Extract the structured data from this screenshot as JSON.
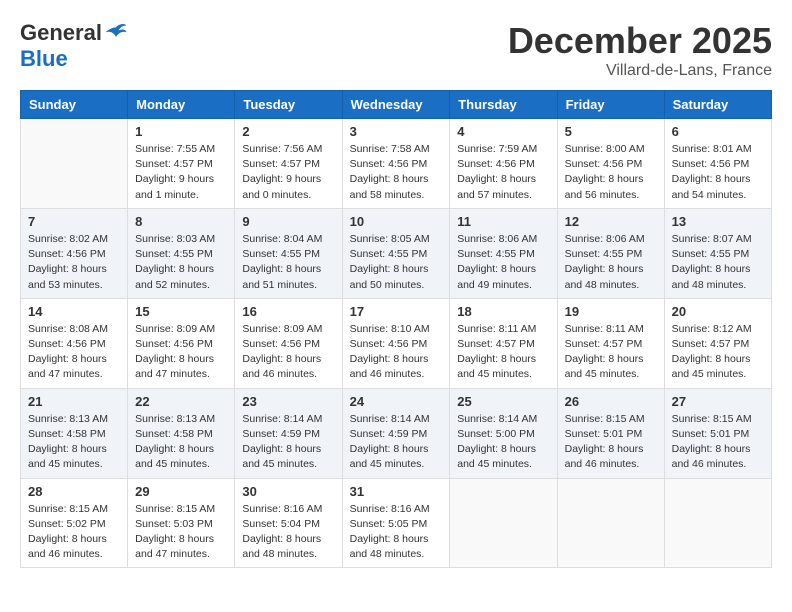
{
  "header": {
    "logo_general": "General",
    "logo_blue": "Blue",
    "title": "December 2025",
    "subtitle": "Villard-de-Lans, France"
  },
  "days_of_week": [
    "Sunday",
    "Monday",
    "Tuesday",
    "Wednesday",
    "Thursday",
    "Friday",
    "Saturday"
  ],
  "weeks": [
    [
      {
        "day": "",
        "info": ""
      },
      {
        "day": "1",
        "info": "Sunrise: 7:55 AM\nSunset: 4:57 PM\nDaylight: 9 hours\nand 1 minute."
      },
      {
        "day": "2",
        "info": "Sunrise: 7:56 AM\nSunset: 4:57 PM\nDaylight: 9 hours\nand 0 minutes."
      },
      {
        "day": "3",
        "info": "Sunrise: 7:58 AM\nSunset: 4:56 PM\nDaylight: 8 hours\nand 58 minutes."
      },
      {
        "day": "4",
        "info": "Sunrise: 7:59 AM\nSunset: 4:56 PM\nDaylight: 8 hours\nand 57 minutes."
      },
      {
        "day": "5",
        "info": "Sunrise: 8:00 AM\nSunset: 4:56 PM\nDaylight: 8 hours\nand 56 minutes."
      },
      {
        "day": "6",
        "info": "Sunrise: 8:01 AM\nSunset: 4:56 PM\nDaylight: 8 hours\nand 54 minutes."
      }
    ],
    [
      {
        "day": "7",
        "info": "Sunrise: 8:02 AM\nSunset: 4:56 PM\nDaylight: 8 hours\nand 53 minutes."
      },
      {
        "day": "8",
        "info": "Sunrise: 8:03 AM\nSunset: 4:55 PM\nDaylight: 8 hours\nand 52 minutes."
      },
      {
        "day": "9",
        "info": "Sunrise: 8:04 AM\nSunset: 4:55 PM\nDaylight: 8 hours\nand 51 minutes."
      },
      {
        "day": "10",
        "info": "Sunrise: 8:05 AM\nSunset: 4:55 PM\nDaylight: 8 hours\nand 50 minutes."
      },
      {
        "day": "11",
        "info": "Sunrise: 8:06 AM\nSunset: 4:55 PM\nDaylight: 8 hours\nand 49 minutes."
      },
      {
        "day": "12",
        "info": "Sunrise: 8:06 AM\nSunset: 4:55 PM\nDaylight: 8 hours\nand 48 minutes."
      },
      {
        "day": "13",
        "info": "Sunrise: 8:07 AM\nSunset: 4:55 PM\nDaylight: 8 hours\nand 48 minutes."
      }
    ],
    [
      {
        "day": "14",
        "info": "Sunrise: 8:08 AM\nSunset: 4:56 PM\nDaylight: 8 hours\nand 47 minutes."
      },
      {
        "day": "15",
        "info": "Sunrise: 8:09 AM\nSunset: 4:56 PM\nDaylight: 8 hours\nand 47 minutes."
      },
      {
        "day": "16",
        "info": "Sunrise: 8:09 AM\nSunset: 4:56 PM\nDaylight: 8 hours\nand 46 minutes."
      },
      {
        "day": "17",
        "info": "Sunrise: 8:10 AM\nSunset: 4:56 PM\nDaylight: 8 hours\nand 46 minutes."
      },
      {
        "day": "18",
        "info": "Sunrise: 8:11 AM\nSunset: 4:57 PM\nDaylight: 8 hours\nand 45 minutes."
      },
      {
        "day": "19",
        "info": "Sunrise: 8:11 AM\nSunset: 4:57 PM\nDaylight: 8 hours\nand 45 minutes."
      },
      {
        "day": "20",
        "info": "Sunrise: 8:12 AM\nSunset: 4:57 PM\nDaylight: 8 hours\nand 45 minutes."
      }
    ],
    [
      {
        "day": "21",
        "info": "Sunrise: 8:13 AM\nSunset: 4:58 PM\nDaylight: 8 hours\nand 45 minutes."
      },
      {
        "day": "22",
        "info": "Sunrise: 8:13 AM\nSunset: 4:58 PM\nDaylight: 8 hours\nand 45 minutes."
      },
      {
        "day": "23",
        "info": "Sunrise: 8:14 AM\nSunset: 4:59 PM\nDaylight: 8 hours\nand 45 minutes."
      },
      {
        "day": "24",
        "info": "Sunrise: 8:14 AM\nSunset: 4:59 PM\nDaylight: 8 hours\nand 45 minutes."
      },
      {
        "day": "25",
        "info": "Sunrise: 8:14 AM\nSunset: 5:00 PM\nDaylight: 8 hours\nand 45 minutes."
      },
      {
        "day": "26",
        "info": "Sunrise: 8:15 AM\nSunset: 5:01 PM\nDaylight: 8 hours\nand 46 minutes."
      },
      {
        "day": "27",
        "info": "Sunrise: 8:15 AM\nSunset: 5:01 PM\nDaylight: 8 hours\nand 46 minutes."
      }
    ],
    [
      {
        "day": "28",
        "info": "Sunrise: 8:15 AM\nSunset: 5:02 PM\nDaylight: 8 hours\nand 46 minutes."
      },
      {
        "day": "29",
        "info": "Sunrise: 8:15 AM\nSunset: 5:03 PM\nDaylight: 8 hours\nand 47 minutes."
      },
      {
        "day": "30",
        "info": "Sunrise: 8:16 AM\nSunset: 5:04 PM\nDaylight: 8 hours\nand 48 minutes."
      },
      {
        "day": "31",
        "info": "Sunrise: 8:16 AM\nSunset: 5:05 PM\nDaylight: 8 hours\nand 48 minutes."
      },
      {
        "day": "",
        "info": ""
      },
      {
        "day": "",
        "info": ""
      },
      {
        "day": "",
        "info": ""
      }
    ]
  ]
}
